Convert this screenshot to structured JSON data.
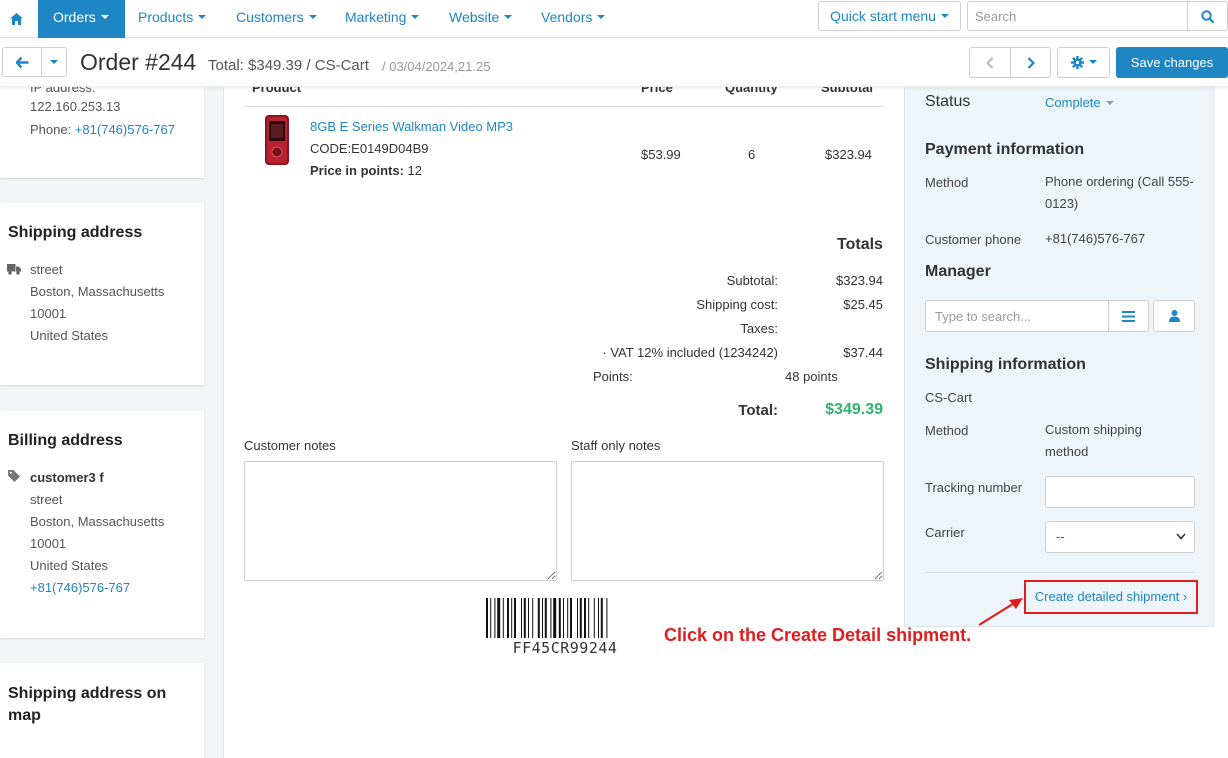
{
  "nav": {
    "items": [
      {
        "label": "Orders",
        "active": true
      },
      {
        "label": "Products"
      },
      {
        "label": "Customers"
      },
      {
        "label": "Marketing"
      },
      {
        "label": "Website"
      },
      {
        "label": "Vendors"
      }
    ],
    "quick_start": "Quick start menu",
    "search_placeholder": "Search"
  },
  "header": {
    "title": "Order #244",
    "total": "Total: $349.39 / CS-Cart",
    "date": "/ 03/04/2024,21.25",
    "save_label": "Save changes"
  },
  "left": {
    "ip_label": "IP address:",
    "ip_value": "122.160.253.13",
    "phone_label": "Phone:",
    "phone_value": "+81(746)576-767",
    "shipping": {
      "title": "Shipping address",
      "street": "street",
      "city": "Boston, Massachusetts",
      "zip": "10001",
      "country": "United States"
    },
    "billing": {
      "title": "Billing address",
      "name": "customer3 f",
      "street": "street",
      "city": "Boston, Massachusetts",
      "zip": "10001",
      "country": "United States",
      "phone": "+81(746)576-767"
    },
    "map_title": "Shipping address on map"
  },
  "products": {
    "headers": {
      "product": "Product",
      "price": "Price",
      "quantity": "Quantity",
      "subtotal": "Subtotal"
    },
    "item": {
      "name": "8GB E Series Walkman Video MP3",
      "code": "CODE:E0149D04B9",
      "points_label": "Price in points:",
      "points_value": "12",
      "price": "$53.99",
      "quantity": "6",
      "subtotal": "$323.94"
    }
  },
  "totals": {
    "title": "Totals",
    "subtotal_label": "Subtotal:",
    "subtotal_value": "$323.94",
    "shipping_label": "Shipping cost:",
    "shipping_value": "$25.45",
    "taxes_label": "Taxes:",
    "vat_label": "· VAT 12% included (1234242)",
    "vat_value": "$37.44",
    "points_label": "Points:",
    "points_value": "48 points",
    "total_label": "Total:",
    "total_value": "$349.39"
  },
  "notes": {
    "customer_label": "Customer notes",
    "staff_label": "Staff only notes"
  },
  "barcode": {
    "code": "FF45CR99244"
  },
  "right": {
    "status_label": "Status",
    "status_value": "Complete",
    "payment_title": "Payment information",
    "method_label": "Method",
    "method_value": "Phone ordering (Call 555-0123)",
    "customer_phone_label": "Customer phone",
    "customer_phone_value": "+81(746)576-767",
    "manager_title": "Manager",
    "manager_placeholder": "Type to search...",
    "shipping_title": "Shipping information",
    "shipping_vendor": "CS-Cart",
    "ship_method_label": "Method",
    "ship_method_value": "Custom shipping method",
    "tracking_label": "Tracking number",
    "carrier_label": "Carrier",
    "carrier_value": "--",
    "create_shipment": "Create detailed shipment ›"
  },
  "annotation": "Click on the Create Detail shipment.",
  "colors": {
    "accent": "#1f86c4",
    "total_green": "#2fb56a",
    "annotation_red": "#e01d1d"
  }
}
